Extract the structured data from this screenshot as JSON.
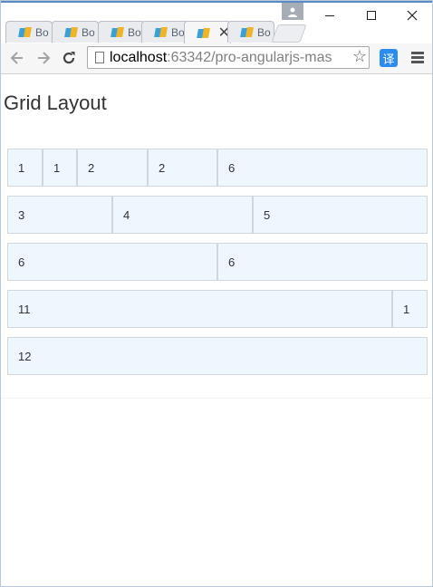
{
  "browser": {
    "tabs": [
      {
        "label": "Bo",
        "active": false
      },
      {
        "label": "Bo",
        "active": false
      },
      {
        "label": "Bo",
        "active": false
      },
      {
        "label": "Bo",
        "active": false
      },
      {
        "label": "",
        "active": true
      },
      {
        "label": "Bo",
        "active": false
      }
    ],
    "active_tab_close": "✕",
    "window_controls": {
      "minimize": "—",
      "maximize": "☐",
      "close": "✕"
    },
    "address": {
      "host": "localhost",
      "path": ":63342/pro-angularjs-mas"
    },
    "translate_label": "译",
    "icons": [
      "back-arrow-icon",
      "forward-arrow-icon",
      "reload-icon",
      "page-icon",
      "star-icon",
      "translate-icon",
      "menu-icon",
      "profile-icon"
    ]
  },
  "page": {
    "title": "Grid Layout",
    "rows": [
      {
        "cells": [
          {
            "label": "1",
            "span": 1
          },
          {
            "label": "1",
            "span": 1
          },
          {
            "label": "2",
            "span": 2
          },
          {
            "label": "2",
            "span": 2
          },
          {
            "label": "6",
            "span": 6
          }
        ]
      },
      {
        "cells": [
          {
            "label": "3",
            "span": 3
          },
          {
            "label": "4",
            "span": 4
          },
          {
            "label": "5",
            "span": 5
          }
        ]
      },
      {
        "cells": [
          {
            "label": "6",
            "span": 6
          },
          {
            "label": "6",
            "span": 6
          }
        ]
      },
      {
        "cells": [
          {
            "label": "11",
            "span": 11
          },
          {
            "label": "1",
            "span": 1
          }
        ]
      },
      {
        "cells": [
          {
            "label": "12",
            "span": 12
          }
        ]
      }
    ]
  },
  "colors": {
    "cell_background": "#eef6fe",
    "cell_border": "#cfd6dd",
    "accent": "#2d8cf0"
  }
}
